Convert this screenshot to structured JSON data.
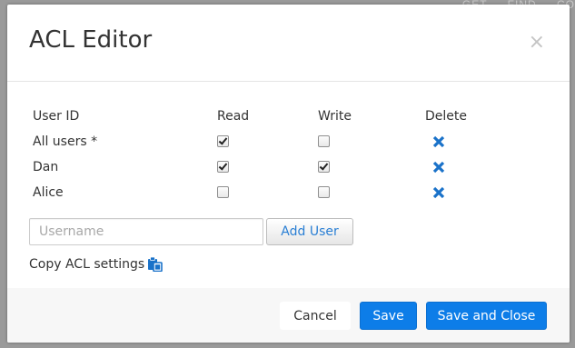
{
  "backdrop": {
    "fragments": [
      "GET",
      "FIND",
      "CO"
    ]
  },
  "dialog": {
    "title": "ACL Editor",
    "close_glyph": "×"
  },
  "table": {
    "headers": {
      "user_id": "User ID",
      "read": "Read",
      "write": "Write",
      "delete": "Delete"
    },
    "rows": [
      {
        "user": "All users *",
        "read": true,
        "write": false,
        "delete_icon": "close-x-icon"
      },
      {
        "user": "Dan",
        "read": true,
        "write": true,
        "delete_icon": "close-x-icon"
      },
      {
        "user": "Alice",
        "read": false,
        "write": false,
        "delete_icon": "close-x-icon"
      }
    ]
  },
  "add_user": {
    "placeholder": "Username",
    "value": "",
    "button_label": "Add User"
  },
  "copy_acl": {
    "label": "Copy ACL settings",
    "icon": "clipboard-icon"
  },
  "footer": {
    "cancel_label": "Cancel",
    "save_label": "Save",
    "save_close_label": "Save and Close"
  },
  "colors": {
    "primary": "#0d7de8",
    "link": "#2a7fd4",
    "delete_icon": "#1a72c9"
  }
}
